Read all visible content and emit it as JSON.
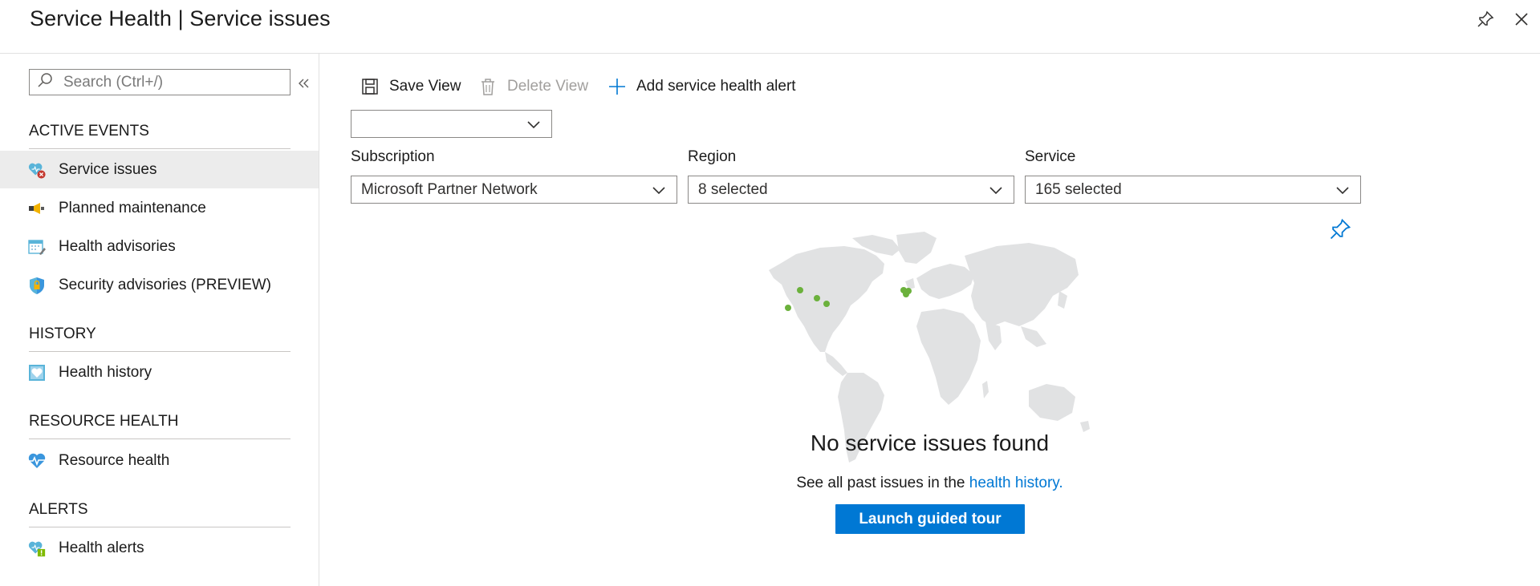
{
  "header": {
    "title": "Service Health | Service issues",
    "pin_icon": "pin-icon",
    "close_icon": "close-icon"
  },
  "sidebar": {
    "search_placeholder": "Search (Ctrl+/)",
    "collapse_icon": "double-chevron-left-icon",
    "sections": {
      "active_events": {
        "header": "ACTIVE EVENTS",
        "items": [
          {
            "label": "Service issues",
            "icon": "heart-error-icon",
            "selected": true
          },
          {
            "label": "Planned maintenance",
            "icon": "megaphone-icon"
          },
          {
            "label": "Health advisories",
            "icon": "calendar-edit-icon"
          },
          {
            "label": "Security advisories (PREVIEW)",
            "icon": "shield-lock-icon"
          }
        ]
      },
      "history": {
        "header": "HISTORY",
        "items": [
          {
            "label": "Health history",
            "icon": "heart-history-icon"
          }
        ]
      },
      "resource_health": {
        "header": "RESOURCE HEALTH",
        "items": [
          {
            "label": "Resource health",
            "icon": "heartbeat-icon"
          }
        ]
      },
      "alerts": {
        "header": "ALERTS",
        "items": [
          {
            "label": "Health alerts",
            "icon": "heart-alert-icon"
          }
        ]
      }
    }
  },
  "toolbar": {
    "save_view": "Save View",
    "delete_view": "Delete View",
    "add_alert": "Add service health alert"
  },
  "filters": {
    "view_select": "",
    "subscription": {
      "label": "Subscription",
      "value": "Microsoft Partner Network"
    },
    "region": {
      "label": "Region",
      "value": "8 selected"
    },
    "service": {
      "label": "Service",
      "value": "165 selected"
    }
  },
  "empty_state": {
    "title": "No service issues found",
    "subtitle_prefix": "See all past issues in the ",
    "subtitle_link": "health history.",
    "button": "Launch guided tour"
  },
  "colors": {
    "accent": "#0078d4",
    "region_dot": "#6bb13c",
    "map_land": "#e1e2e3",
    "selected_bg": "#ececec"
  }
}
